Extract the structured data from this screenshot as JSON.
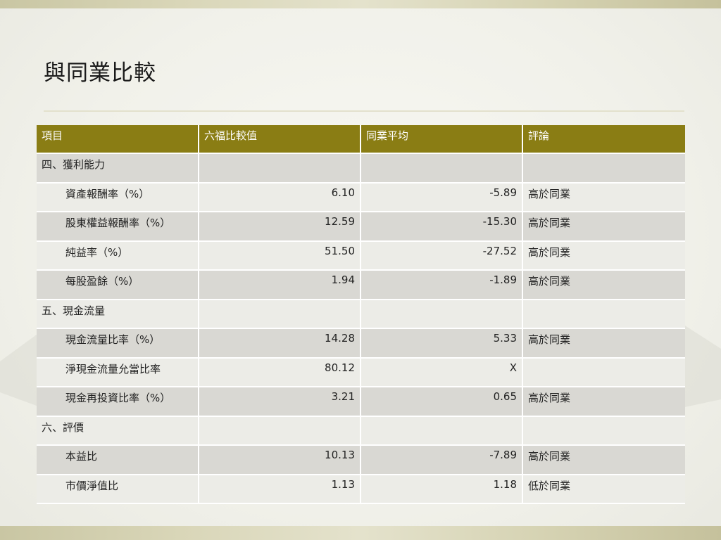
{
  "slide": {
    "title": "與同業比較"
  },
  "table": {
    "headers": [
      "項目",
      "六福比較值",
      "同業平均",
      "評論"
    ],
    "rows": [
      {
        "item": "四、獲利能力",
        "value": "",
        "average": "",
        "comment": "",
        "indent": false
      },
      {
        "item": "資產報酬率（%）",
        "value": "6.10",
        "average": "-5.89",
        "comment": "高於同業",
        "indent": true
      },
      {
        "item": "股東權益報酬率（%）",
        "value": "12.59",
        "average": "-15.30",
        "comment": "高於同業",
        "indent": true
      },
      {
        "item": "純益率（%）",
        "value": "51.50",
        "average": "-27.52",
        "comment": "高於同業",
        "indent": true
      },
      {
        "item": "每股盈餘（%）",
        "value": "1.94",
        "average": "-1.89",
        "comment": "高於同業",
        "indent": true
      },
      {
        "item": "五、現金流量",
        "value": "",
        "average": "",
        "comment": "",
        "indent": false
      },
      {
        "item": "現金流量比率（%）",
        "value": "14.28",
        "average": "5.33",
        "comment": "高於同業",
        "indent": true
      },
      {
        "item": "淨現金流量允當比率",
        "value": "80.12",
        "average": "X",
        "comment": "",
        "indent": true
      },
      {
        "item": "現金再投資比率（%）",
        "value": "3.21",
        "average": "0.65",
        "comment": "高於同業",
        "indent": true
      },
      {
        "item": "六、評價",
        "value": "",
        "average": "",
        "comment": "",
        "indent": false
      },
      {
        "item": "本益比",
        "value": "10.13",
        "average": "-7.89",
        "comment": "高於同業",
        "indent": true
      },
      {
        "item": "市價淨值比",
        "value": "1.13",
        "average": "1.18",
        "comment": "低於同業",
        "indent": true
      }
    ]
  },
  "colors": {
    "header_bg": "#8a7d14",
    "row_dark": "#d9d8d3",
    "row_light": "#ecece7"
  }
}
